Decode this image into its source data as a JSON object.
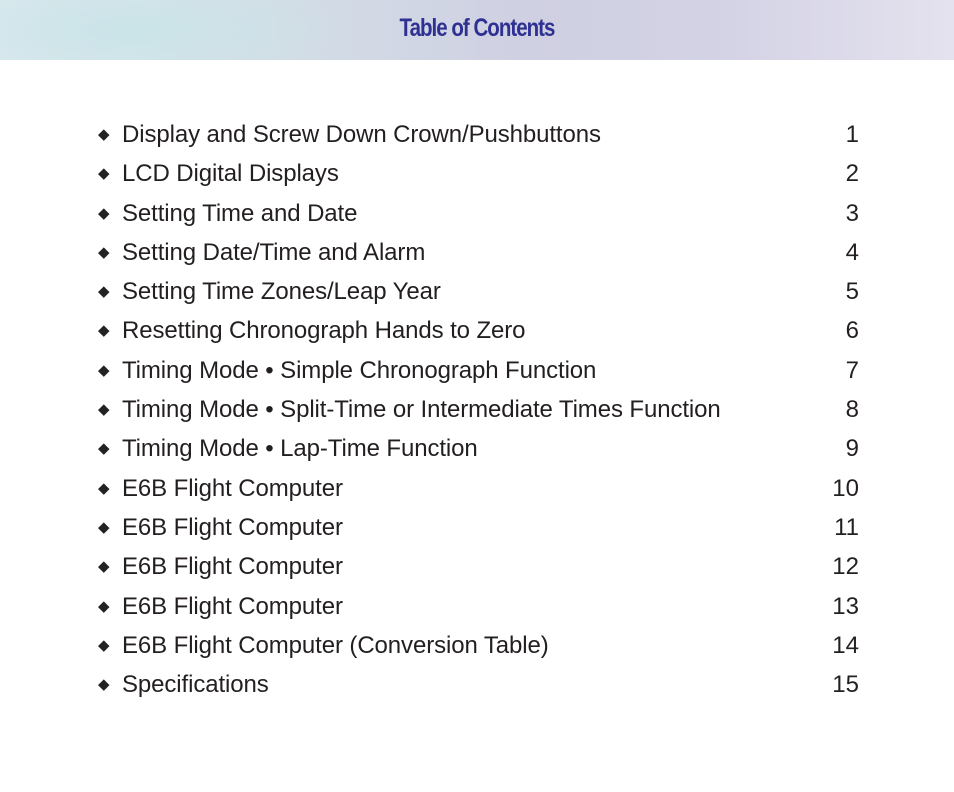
{
  "header": {
    "title": "Table of Contents"
  },
  "bullet_icon": "diamond-bullet",
  "toc": [
    {
      "title": "Display and Screw Down Crown/Pushbuttons",
      "page": "1"
    },
    {
      "title": "LCD Digital Displays",
      "page": "2"
    },
    {
      "title": "Setting Time and Date",
      "page": "3"
    },
    {
      "title": "Setting Date/Time and Alarm",
      "page": "4"
    },
    {
      "title": "Setting Time Zones/Leap Year",
      "page": "5"
    },
    {
      "title": "Resetting Chronograph Hands to Zero",
      "page": "6"
    },
    {
      "title": "Timing Mode • Simple Chronograph Function",
      "page": "7"
    },
    {
      "title": "Timing Mode • Split-Time or Intermediate Times Function",
      "page": "8"
    },
    {
      "title": "Timing Mode • Lap-Time Function",
      "page": "9"
    },
    {
      "title": "E6B Flight Computer",
      "page": "10"
    },
    {
      "title": "E6B Flight Computer",
      "page": "11"
    },
    {
      "title": "E6B Flight Computer",
      "page": "12"
    },
    {
      "title": "E6B Flight Computer",
      "page": "13"
    },
    {
      "title": "E6B Flight Computer (Conversion Table)",
      "page": "14"
    },
    {
      "title": "Specifications",
      "page": "15"
    }
  ]
}
